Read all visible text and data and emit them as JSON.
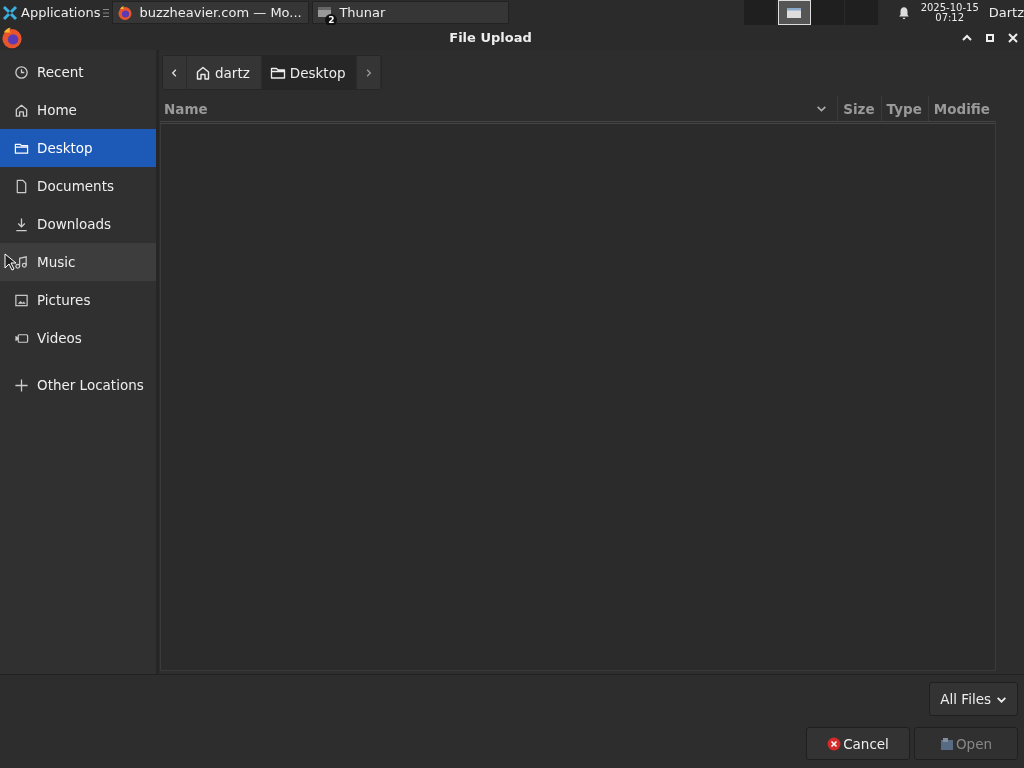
{
  "taskbar": {
    "menu_label": "Applications",
    "tasks": [
      {
        "label": "buzzheavier.com — Mo...",
        "kind": "browser",
        "selected": false
      },
      {
        "label": "Thunar",
        "kind": "files",
        "selected": false,
        "badge": "2"
      }
    ],
    "workspaces": [
      {
        "selected": false,
        "has_window": false
      },
      {
        "selected": true,
        "has_window": true
      },
      {
        "selected": false,
        "has_window": false
      },
      {
        "selected": false,
        "has_window": false
      }
    ],
    "date": "2025-10-15",
    "time": "07:12",
    "user": "Dartz"
  },
  "window": {
    "title": "File Upload"
  },
  "sidebar": {
    "items": [
      {
        "label": "Recent",
        "kind": "recent",
        "selected": false,
        "hovered": false
      },
      {
        "label": "Home",
        "kind": "home",
        "selected": false,
        "hovered": false
      },
      {
        "label": "Desktop",
        "kind": "folder",
        "selected": true,
        "hovered": false
      },
      {
        "label": "Documents",
        "kind": "document",
        "selected": false,
        "hovered": false
      },
      {
        "label": "Downloads",
        "kind": "download",
        "selected": false,
        "hovered": false
      },
      {
        "label": "Music",
        "kind": "music",
        "selected": false,
        "hovered": true
      },
      {
        "label": "Pictures",
        "kind": "picture",
        "selected": false,
        "hovered": false
      },
      {
        "label": "Videos",
        "kind": "video",
        "selected": false,
        "hovered": false
      }
    ],
    "other": {
      "label": "Other Locations",
      "kind": "add"
    }
  },
  "path_bar": {
    "crumbs": [
      {
        "label": "dartz",
        "kind": "home",
        "selected": false
      },
      {
        "label": "Desktop",
        "kind": "folder",
        "selected": true
      }
    ]
  },
  "table": {
    "columns": [
      "Name",
      "Size",
      "Type",
      "Modifie"
    ]
  },
  "filter": {
    "value": "All Files"
  },
  "buttons": [
    {
      "label": "Cancel",
      "kind": "cancel",
      "disabled": false
    },
    {
      "label": "Open",
      "kind": "open",
      "disabled": true
    }
  ]
}
